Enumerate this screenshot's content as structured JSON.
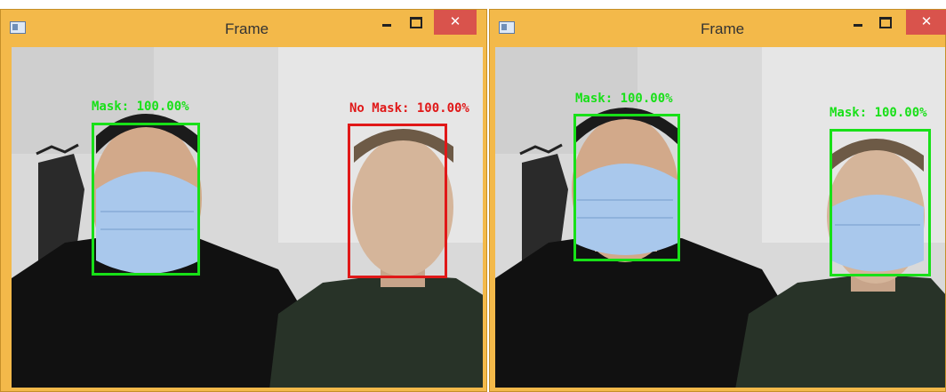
{
  "windows": [
    {
      "title": "Frame",
      "controls": {
        "close": "✕"
      },
      "detections": [
        {
          "label": "Mask: 100.00%",
          "status": "mask",
          "color": "#18e018"
        },
        {
          "label": "No Mask: 100.00%",
          "status": "no-mask",
          "color": "#e01818"
        }
      ]
    },
    {
      "title": "Frame",
      "controls": {
        "close": "✕"
      },
      "detections": [
        {
          "label": "Mask: 100.00%",
          "status": "mask",
          "color": "#18e018"
        },
        {
          "label": "Mask: 100.00%",
          "status": "mask",
          "color": "#18e018"
        }
      ]
    }
  ],
  "colors": {
    "window_frame": "#f3b94a",
    "close_button": "#d9534c",
    "mask": "#18e018",
    "no_mask": "#e01818"
  },
  "icons": {
    "app": "app-window-icon",
    "minimize": "minimize-icon",
    "maximize": "maximize-icon",
    "close": "close-icon"
  }
}
